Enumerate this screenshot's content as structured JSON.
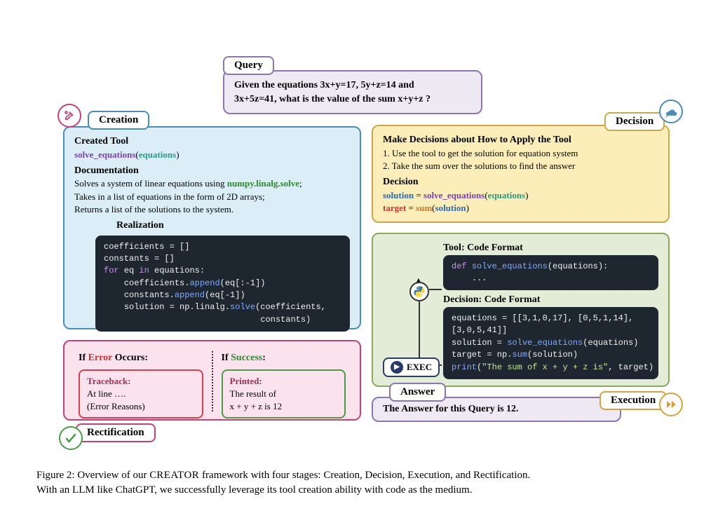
{
  "query": {
    "label": "Query",
    "line1": "Given the equations 3x+y=17, 5y+z=14 and",
    "line2": "3x+5z=41, what is the value of the sum x+y+z ?"
  },
  "creation": {
    "label": "Creation",
    "h1": "Created Tool",
    "tool_name": "solve_equations",
    "tool_arg": "equations",
    "doc_h": "Documentation",
    "doc_l1a": "Solves a system of linear equations using ",
    "doc_l1b": "numpy.linalg.solve",
    "doc_l1c": ";",
    "doc_l2": "Takes in a list of equations in the form of 2D arrays;",
    "doc_l3": "Returns a list of the solutions to the system.",
    "real_h": "Realization",
    "code": "coefficients = []\nconstants = []\nfor eq in equations:\n    coefficients.append(eq[:-1])\n    constants.append(eq[-1])\n    solution = np.linalg.solve(coefficients,\n                               constants)"
  },
  "decision": {
    "label": "Decision",
    "h1": "Make Decisions about How to Apply the Tool",
    "step1": "1.   Use the tool to get the solution for equation system",
    "step2": "2.   Take the sum over the solutions to find the answer",
    "dec_h": "Decision",
    "l1_a": "solution",
    "l1_b": " = ",
    "l1_c": "solve_equations",
    "l1_d": "(",
    "l1_e": "equations",
    "l1_f": ")",
    "l2_a": "target",
    "l2_b": " = ",
    "l2_c": "sum",
    "l2_d": "(",
    "l2_e": "solution",
    "l2_f": ")"
  },
  "execution": {
    "label": "Execution",
    "tool_h": "Tool: Code Format",
    "tool_code": "def solve_equations(equations):\n    ...",
    "dec_h": "Decision: Code Format",
    "dec_code": "equations = [[3,1,0,17], [0,5,1,14],\n[3,0,5,41]]\nsolution = solve_equations(equations)\ntarget = np.sum(solution)\nprint(\"The sum of x + y + z is\", target)",
    "exec_btn": "EXEC"
  },
  "rectification": {
    "label": "Rectification",
    "if_error_a": "If ",
    "if_error_b": "Error",
    "if_error_c": " Occurs:",
    "if_success_a": "If ",
    "if_success_b": "Success",
    "if_success_c": ":",
    "err_h": "Traceback:",
    "err_l1": "At line ….",
    "err_l2": "(Error Reasons)",
    "suc_h": "Printed:",
    "suc_l1": "The result of",
    "suc_l2": "x + y + z  is 12"
  },
  "answer": {
    "label": "Answer",
    "text": "The Answer for this Query is 12."
  },
  "caption": {
    "l1a": "Figure 2: Overview of our C",
    "l1b": "REATOR",
    "l1c": " framework with four stages: Creation, Decision, Execution, and Rectification.",
    "l2": "With an LLM like ChatGPT, we successfully leverage its tool creation ability with code as the medium."
  }
}
